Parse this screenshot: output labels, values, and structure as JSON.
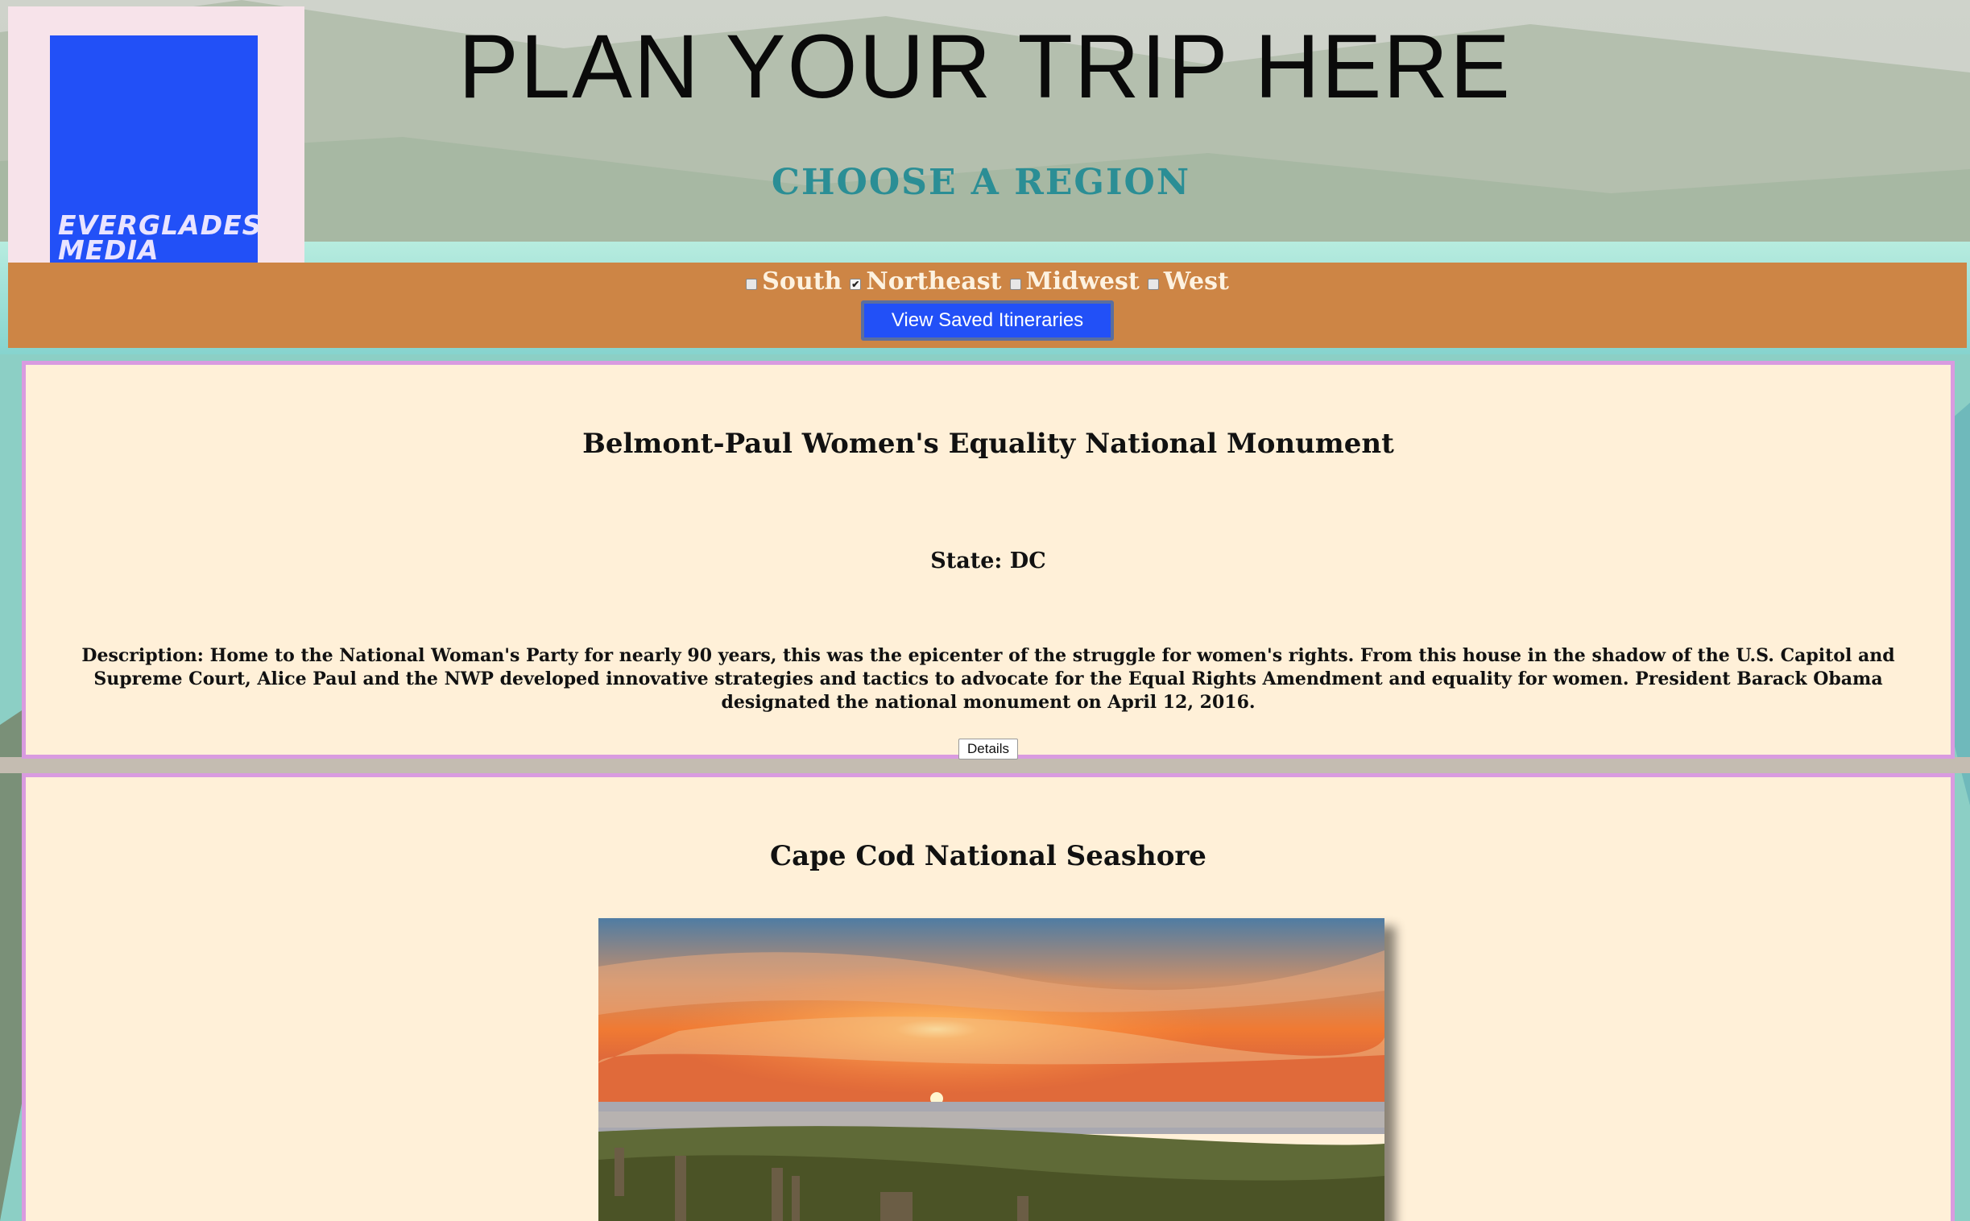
{
  "logo": {
    "text": "EVERGLADES MEDIA"
  },
  "header": {
    "title": "PLAN YOUR TRIP HERE",
    "subtitle": "CHOOSE A REGION"
  },
  "regions": [
    {
      "label": "South",
      "checked": false
    },
    {
      "label": "Northeast",
      "checked": true
    },
    {
      "label": "Midwest",
      "checked": false
    },
    {
      "label": "West",
      "checked": false
    }
  ],
  "nav": {
    "saved_label": "View Saved Itineraries"
  },
  "cards": [
    {
      "title": "Belmont-Paul Women's Equality National Monument",
      "state": "State: DC",
      "description": "Description: Home to the National Woman's Party for nearly 90 years, this was the epicenter of the struggle for women's rights. From this house in the shadow of the U.S. Capitol and Supreme Court, Alice Paul and the NWP developed innovative strategies and tactics to advocate for the Equal Rights Amendment and equality for women. President Barack Obama designated the national monument on April 12, 2016.",
      "details_label": "Details"
    },
    {
      "title": "Cape Cod National Seashore"
    }
  ]
}
